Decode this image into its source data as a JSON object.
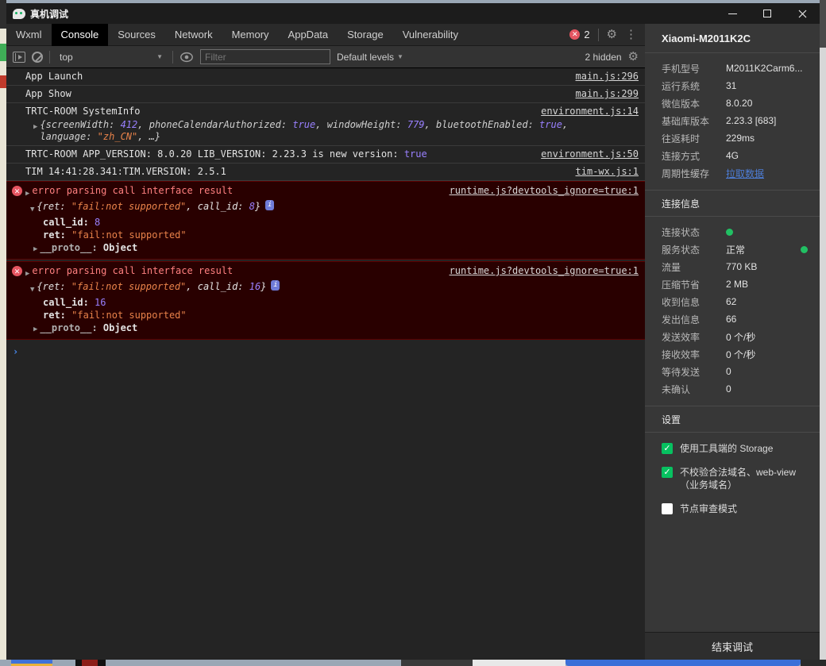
{
  "window": {
    "title": "真机调试"
  },
  "tabs": [
    "Wxml",
    "Console",
    "Sources",
    "Network",
    "Memory",
    "AppData",
    "Storage",
    "Vulnerability"
  ],
  "tabbar": {
    "error_count": "2"
  },
  "toolbar": {
    "context": "top",
    "filter_placeholder": "Filter",
    "levels": "Default levels",
    "hidden_label": "2 hidden"
  },
  "console": {
    "messages": {
      "m0": {
        "text": "App Launch",
        "link": "main.js:296"
      },
      "m1": {
        "text": "App Show",
        "link": "main.js:299"
      },
      "m4": {
        "text": "TIM 14:41:28.341:TIM.VERSION: 2.5.1",
        "link": "tim-wx.js:1"
      }
    },
    "sysinfo": {
      "title": "TRTC-ROOM SystemInfo",
      "link": "environment.js:14",
      "parts": [
        "{screenWidth: ",
        "412",
        ", phoneCalendarAuthorized: ",
        "true",
        ", windowHeight: ",
        "779",
        ", bluetoothEnabled: ",
        "true",
        ", language: ",
        "\"zh_CN\"",
        ", …}"
      ]
    },
    "version_msg": {
      "text": "TRTC-ROOM APP_VERSION: 8.0.20  LIB_VERSION: 2.23.3  is new version: ",
      "bool": "true",
      "link": "environment.js:50"
    },
    "errors": {
      "e0": {
        "title": "error parsing call interface result",
        "link": "runtime.js?devtools_ignore=true:1",
        "p1": "{ret: ",
        "str": "\"fail:not supported\"",
        "p2": ", call_id: ",
        "num": "8",
        "p3": "}",
        "k1": "call_id:",
        "v1": "8",
        "k2": "ret:",
        "v2": "\"fail:not supported\"",
        "k3": "__proto__:",
        "v3": "Object"
      },
      "e1": {
        "title": "error parsing call interface result",
        "link": "runtime.js?devtools_ignore=true:1",
        "p1": "{ret: ",
        "str": "\"fail:not supported\"",
        "p2": ", call_id: ",
        "num": "16",
        "p3": "}",
        "k1": "call_id:",
        "v1": "16",
        "k2": "ret:",
        "v2": "\"fail:not supported\"",
        "k3": "__proto__:",
        "v3": "Object"
      }
    },
    "info_badge_glyph": "i"
  },
  "panel": {
    "device_name": "Xiaomi-M2011K2C",
    "device_rows": {
      "r0": {
        "label": "手机型号",
        "value": "M2011K2Carm6..."
      },
      "r1": {
        "label": "运行系统",
        "value": "31"
      },
      "r2": {
        "label": "微信版本",
        "value": "8.0.20"
      },
      "r3": {
        "label": "基础库版本",
        "value": "2.23.3 [683]"
      },
      "r4": {
        "label": "往返耗时",
        "value": "229ms"
      },
      "r5": {
        "label": "连接方式",
        "value": "4G"
      },
      "r6": {
        "label": "周期性缓存",
        "value": "拉取数据"
      }
    },
    "connection": {
      "title": "连接信息",
      "rows": {
        "r0": {
          "label": "连接状态",
          "value": ""
        },
        "r1": {
          "label": "服务状态",
          "value": "正常"
        },
        "r2": {
          "label": "流量",
          "value": "770 KB"
        },
        "r3": {
          "label": "压缩节省",
          "value": "2 MB"
        },
        "r4": {
          "label": "收到信息",
          "value": "62"
        },
        "r5": {
          "label": "发出信息",
          "value": "66"
        },
        "r6": {
          "label": "发送效率",
          "value": "0 个/秒"
        },
        "r7": {
          "label": "接收效率",
          "value": "0 个/秒"
        },
        "r8": {
          "label": "等待发送",
          "value": "0"
        },
        "r9": {
          "label": "未确认",
          "value": "0"
        }
      }
    },
    "settings": {
      "title": "设置",
      "items": {
        "s0": {
          "label": "使用工具端的 Storage",
          "check": "✓"
        },
        "s1": {
          "label": "不校验合法域名、web-view（业务域名）",
          "check": "✓"
        },
        "s2": {
          "label": "节点审查模式",
          "check": ""
        }
      }
    },
    "end_button": "结束调试"
  }
}
